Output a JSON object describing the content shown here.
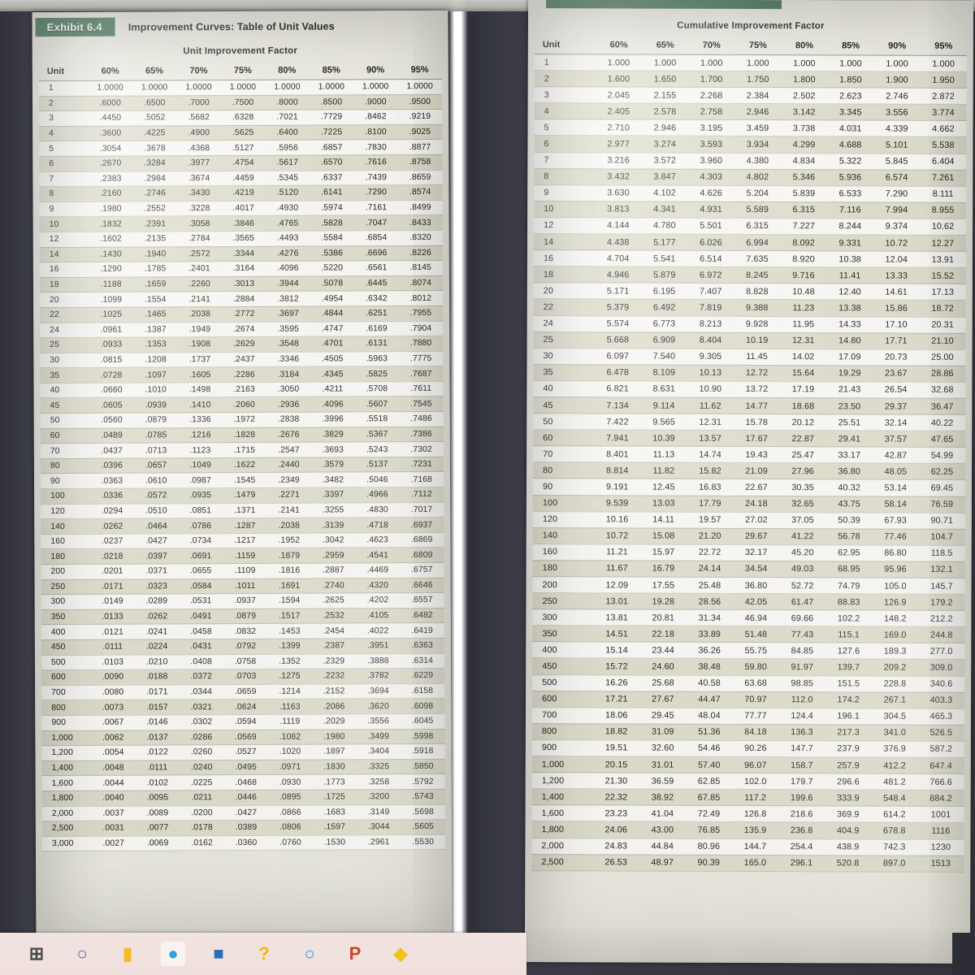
{
  "exhibit": {
    "tag": "Exhibit 6.4",
    "title": "Improvement Curves: Table of Unit Values"
  },
  "left_table": {
    "caption": "Unit Improvement Factor",
    "columns": [
      "Unit",
      "60%",
      "65%",
      "70%",
      "75%",
      "80%",
      "85%",
      "90%",
      "95%"
    ],
    "rows": [
      [
        "1",
        "1.0000",
        "1.0000",
        "1.0000",
        "1.0000",
        "1.0000",
        "1.0000",
        "1.0000",
        "1.0000"
      ],
      [
        "2",
        ".6000",
        ".6500",
        ".7000",
        ".7500",
        ".8000",
        ".8500",
        ".9000",
        ".9500"
      ],
      [
        "3",
        ".4450",
        ".5052",
        ".5682",
        ".6328",
        ".7021",
        ".7729",
        ".8462",
        ".9219"
      ],
      [
        "4",
        ".3600",
        ".4225",
        ".4900",
        ".5625",
        ".6400",
        ".7225",
        ".8100",
        ".9025"
      ],
      [
        "5",
        ".3054",
        ".3678",
        ".4368",
        ".5127",
        ".5956",
        ".6857",
        ".7830",
        ".8877"
      ],
      [
        "6",
        ".2670",
        ".3284",
        ".3977",
        ".4754",
        ".5617",
        ".6570",
        ".7616",
        ".8758"
      ],
      [
        "7",
        ".2383",
        ".2984",
        ".3674",
        ".4459",
        ".5345",
        ".6337",
        ".7439",
        ".8659"
      ],
      [
        "8",
        ".2160",
        ".2746",
        ".3430",
        ".4219",
        ".5120",
        ".6141",
        ".7290",
        ".8574"
      ],
      [
        "9",
        ".1980",
        ".2552",
        ".3228",
        ".4017",
        ".4930",
        ".5974",
        ".7161",
        ".8499"
      ],
      [
        "10",
        ".1832",
        ".2391",
        ".3058",
        ".3846",
        ".4765",
        ".5828",
        ".7047",
        ".8433"
      ],
      [
        "12",
        ".1602",
        ".2135",
        ".2784",
        ".3565",
        ".4493",
        ".5584",
        ".6854",
        ".8320"
      ],
      [
        "14",
        ".1430",
        ".1940",
        ".2572",
        ".3344",
        ".4276",
        ".5386",
        ".6696",
        ".8226"
      ],
      [
        "16",
        ".1290",
        ".1785",
        ".2401",
        ".3164",
        ".4096",
        ".5220",
        ".6561",
        ".8145"
      ],
      [
        "18",
        ".1188",
        ".1659",
        ".2260",
        ".3013",
        ".3944",
        ".5078",
        ".6445",
        ".8074"
      ],
      [
        "20",
        ".1099",
        ".1554",
        ".2141",
        ".2884",
        ".3812",
        ".4954",
        ".6342",
        ".8012"
      ],
      [
        "22",
        ".1025",
        ".1465",
        ".2038",
        ".2772",
        ".3697",
        ".4844",
        ".6251",
        ".7955"
      ],
      [
        "24",
        ".0961",
        ".1387",
        ".1949",
        ".2674",
        ".3595",
        ".4747",
        ".6169",
        ".7904"
      ],
      [
        "25",
        ".0933",
        ".1353",
        ".1908",
        ".2629",
        ".3548",
        ".4701",
        ".6131",
        ".7880"
      ],
      [
        "30",
        ".0815",
        ".1208",
        ".1737",
        ".2437",
        ".3346",
        ".4505",
        ".5963",
        ".7775"
      ],
      [
        "35",
        ".0728",
        ".1097",
        ".1605",
        ".2286",
        ".3184",
        ".4345",
        ".5825",
        ".7687"
      ],
      [
        "40",
        ".0660",
        ".1010",
        ".1498",
        ".2163",
        ".3050",
        ".4211",
        ".5708",
        ".7611"
      ],
      [
        "45",
        ".0605",
        ".0939",
        ".1410",
        ".2060",
        ".2936",
        ".4096",
        ".5607",
        ".7545"
      ],
      [
        "50",
        ".0560",
        ".0879",
        ".1336",
        ".1972",
        ".2838",
        ".3996",
        ".5518",
        ".7486"
      ],
      [
        "60",
        ".0489",
        ".0785",
        ".1216",
        ".1828",
        ".2676",
        ".3829",
        ".5367",
        ".7386"
      ],
      [
        "70",
        ".0437",
        ".0713",
        ".1123",
        ".1715",
        ".2547",
        ".3693",
        ".5243",
        ".7302"
      ],
      [
        "80",
        ".0396",
        ".0657",
        ".1049",
        ".1622",
        ".2440",
        ".3579",
        ".5137",
        ".7231"
      ],
      [
        "90",
        ".0363",
        ".0610",
        ".0987",
        ".1545",
        ".2349",
        ".3482",
        ".5046",
        ".7168"
      ],
      [
        "100",
        ".0336",
        ".0572",
        ".0935",
        ".1479",
        ".2271",
        ".3397",
        ".4966",
        ".7112"
      ],
      [
        "120",
        ".0294",
        ".0510",
        ".0851",
        ".1371",
        ".2141",
        ".3255",
        ".4830",
        ".7017"
      ],
      [
        "140",
        ".0262",
        ".0464",
        ".0786",
        ".1287",
        ".2038",
        ".3139",
        ".4718",
        ".6937"
      ],
      [
        "160",
        ".0237",
        ".0427",
        ".0734",
        ".1217",
        ".1952",
        ".3042",
        ".4623",
        ".6869"
      ],
      [
        "180",
        ".0218",
        ".0397",
        ".0691",
        ".1159",
        ".1879",
        ".2959",
        ".4541",
        ".6809"
      ],
      [
        "200",
        ".0201",
        ".0371",
        ".0655",
        ".1109",
        ".1816",
        ".2887",
        ".4469",
        ".6757"
      ],
      [
        "250",
        ".0171",
        ".0323",
        ".0584",
        ".1011",
        ".1691",
        ".2740",
        ".4320",
        ".6646"
      ],
      [
        "300",
        ".0149",
        ".0289",
        ".0531",
        ".0937",
        ".1594",
        ".2625",
        ".4202",
        ".6557"
      ],
      [
        "350",
        ".0133",
        ".0262",
        ".0491",
        ".0879",
        ".1517",
        ".2532",
        ".4105",
        ".6482"
      ],
      [
        "400",
        ".0121",
        ".0241",
        ".0458",
        ".0832",
        ".1453",
        ".2454",
        ".4022",
        ".6419"
      ],
      [
        "450",
        ".0111",
        ".0224",
        ".0431",
        ".0792",
        ".1399",
        ".2387",
        ".3951",
        ".6363"
      ],
      [
        "500",
        ".0103",
        ".0210",
        ".0408",
        ".0758",
        ".1352",
        ".2329",
        ".3888",
        ".6314"
      ],
      [
        "600",
        ".0090",
        ".0188",
        ".0372",
        ".0703",
        ".1275",
        ".2232",
        ".3782",
        ".6229"
      ],
      [
        "700",
        ".0080",
        ".0171",
        ".0344",
        ".0659",
        ".1214",
        ".2152",
        ".3694",
        ".6158"
      ],
      [
        "800",
        ".0073",
        ".0157",
        ".0321",
        ".0624",
        ".1163",
        ".2086",
        ".3620",
        ".6098"
      ],
      [
        "900",
        ".0067",
        ".0146",
        ".0302",
        ".0594",
        ".1119",
        ".2029",
        ".3556",
        ".6045"
      ],
      [
        "1,000",
        ".0062",
        ".0137",
        ".0286",
        ".0569",
        ".1082",
        ".1980",
        ".3499",
        ".5998"
      ],
      [
        "1,200",
        ".0054",
        ".0122",
        ".0260",
        ".0527",
        ".1020",
        ".1897",
        ".3404",
        ".5918"
      ],
      [
        "1,400",
        ".0048",
        ".0111",
        ".0240",
        ".0495",
        ".0971",
        ".1830",
        ".3325",
        ".5850"
      ],
      [
        "1,600",
        ".0044",
        ".0102",
        ".0225",
        ".0468",
        ".0930",
        ".1773",
        ".3258",
        ".5792"
      ],
      [
        "1,800",
        ".0040",
        ".0095",
        ".0211",
        ".0446",
        ".0895",
        ".1725",
        ".3200",
        ".5743"
      ],
      [
        "2,000",
        ".0037",
        ".0089",
        ".0200",
        ".0427",
        ".0866",
        ".1683",
        ".3149",
        ".5698"
      ],
      [
        "2,500",
        ".0031",
        ".0077",
        ".0178",
        ".0389",
        ".0806",
        ".1597",
        ".3044",
        ".5605"
      ],
      [
        "3,000",
        ".0027",
        ".0069",
        ".0162",
        ".0360",
        ".0760",
        ".1530",
        ".2961",
        ".5530"
      ]
    ]
  },
  "right_table": {
    "caption": "Cumulative Improvement Factor",
    "columns": [
      "Unit",
      "60%",
      "65%",
      "70%",
      "75%",
      "80%",
      "85%",
      "90%",
      "95%"
    ],
    "rows": [
      [
        "1",
        "1.000",
        "1.000",
        "1.000",
        "1.000",
        "1.000",
        "1.000",
        "1.000",
        "1.000"
      ],
      [
        "2",
        "1.600",
        "1.650",
        "1.700",
        "1.750",
        "1.800",
        "1.850",
        "1.900",
        "1.950"
      ],
      [
        "3",
        "2.045",
        "2.155",
        "2.268",
        "2.384",
        "2.502",
        "2.623",
        "2.746",
        "2.872"
      ],
      [
        "4",
        "2.405",
        "2.578",
        "2.758",
        "2.946",
        "3.142",
        "3.345",
        "3.556",
        "3.774"
      ],
      [
        "5",
        "2.710",
        "2.946",
        "3.195",
        "3.459",
        "3.738",
        "4.031",
        "4.339",
        "4.662"
      ],
      [
        "6",
        "2.977",
        "3.274",
        "3.593",
        "3.934",
        "4.299",
        "4.688",
        "5.101",
        "5.538"
      ],
      [
        "7",
        "3.216",
        "3.572",
        "3.960",
        "4.380",
        "4.834",
        "5.322",
        "5.845",
        "6.404"
      ],
      [
        "8",
        "3.432",
        "3.847",
        "4.303",
        "4.802",
        "5.346",
        "5.936",
        "6.574",
        "7.261"
      ],
      [
        "9",
        "3.630",
        "4.102",
        "4.626",
        "5.204",
        "5.839",
        "6.533",
        "7.290",
        "8.111"
      ],
      [
        "10",
        "3.813",
        "4.341",
        "4.931",
        "5.589",
        "6.315",
        "7.116",
        "7.994",
        "8.955"
      ],
      [
        "12",
        "4.144",
        "4.780",
        "5.501",
        "6.315",
        "7.227",
        "8.244",
        "9.374",
        "10.62"
      ],
      [
        "14",
        "4.438",
        "5.177",
        "6.026",
        "6.994",
        "8.092",
        "9.331",
        "10.72",
        "12.27"
      ],
      [
        "16",
        "4.704",
        "5.541",
        "6.514",
        "7.635",
        "8.920",
        "10.38",
        "12.04",
        "13.91"
      ],
      [
        "18",
        "4.946",
        "5.879",
        "6.972",
        "8.245",
        "9.716",
        "11.41",
        "13.33",
        "15.52"
      ],
      [
        "20",
        "5.171",
        "6.195",
        "7.407",
        "8.828",
        "10.48",
        "12.40",
        "14.61",
        "17.13"
      ],
      [
        "22",
        "5.379",
        "6.492",
        "7.819",
        "9.388",
        "11.23",
        "13.38",
        "15.86",
        "18.72"
      ],
      [
        "24",
        "5.574",
        "6.773",
        "8.213",
        "9.928",
        "11.95",
        "14.33",
        "17.10",
        "20.31"
      ],
      [
        "25",
        "5.668",
        "6.909",
        "8.404",
        "10.19",
        "12.31",
        "14.80",
        "17.71",
        "21.10"
      ],
      [
        "30",
        "6.097",
        "7.540",
        "9.305",
        "11.45",
        "14.02",
        "17.09",
        "20.73",
        "25.00"
      ],
      [
        "35",
        "6.478",
        "8.109",
        "10.13",
        "12.72",
        "15.64",
        "19.29",
        "23.67",
        "28.86"
      ],
      [
        "40",
        "6.821",
        "8.631",
        "10.90",
        "13.72",
        "17.19",
        "21.43",
        "26.54",
        "32.68"
      ],
      [
        "45",
        "7.134",
        "9.114",
        "11.62",
        "14.77",
        "18.68",
        "23.50",
        "29.37",
        "36.47"
      ],
      [
        "50",
        "7.422",
        "9.565",
        "12.31",
        "15.78",
        "20.12",
        "25.51",
        "32.14",
        "40.22"
      ],
      [
        "60",
        "7.941",
        "10.39",
        "13.57",
        "17.67",
        "22.87",
        "29.41",
        "37.57",
        "47.65"
      ],
      [
        "70",
        "8.401",
        "11.13",
        "14.74",
        "19.43",
        "25.47",
        "33.17",
        "42.87",
        "54.99"
      ],
      [
        "80",
        "8.814",
        "11.82",
        "15.82",
        "21.09",
        "27.96",
        "36.80",
        "48.05",
        "62.25"
      ],
      [
        "90",
        "9.191",
        "12.45",
        "16.83",
        "22.67",
        "30.35",
        "40.32",
        "53.14",
        "69.45"
      ],
      [
        "100",
        "9.539",
        "13.03",
        "17.79",
        "24.18",
        "32.65",
        "43.75",
        "58.14",
        "76.59"
      ],
      [
        "120",
        "10.16",
        "14.11",
        "19.57",
        "27.02",
        "37.05",
        "50.39",
        "67.93",
        "90.71"
      ],
      [
        "140",
        "10.72",
        "15.08",
        "21.20",
        "29.67",
        "41.22",
        "56.78",
        "77.46",
        "104.7"
      ],
      [
        "160",
        "11.21",
        "15.97",
        "22.72",
        "32.17",
        "45.20",
        "62.95",
        "86.80",
        "118.5"
      ],
      [
        "180",
        "11.67",
        "16.79",
        "24.14",
        "34.54",
        "49.03",
        "68.95",
        "95.96",
        "132.1"
      ],
      [
        "200",
        "12.09",
        "17.55",
        "25.48",
        "36.80",
        "52.72",
        "74.79",
        "105.0",
        "145.7"
      ],
      [
        "250",
        "13.01",
        "19.28",
        "28.56",
        "42.05",
        "61.47",
        "88.83",
        "126.9",
        "179.2"
      ],
      [
        "300",
        "13.81",
        "20.81",
        "31.34",
        "46.94",
        "69.66",
        "102.2",
        "148.2",
        "212.2"
      ],
      [
        "350",
        "14.51",
        "22.18",
        "33.89",
        "51.48",
        "77.43",
        "115.1",
        "169.0",
        "244.8"
      ],
      [
        "400",
        "15.14",
        "23.44",
        "36.26",
        "55.75",
        "84.85",
        "127.6",
        "189.3",
        "277.0"
      ],
      [
        "450",
        "15.72",
        "24.60",
        "38.48",
        "59.80",
        "91.97",
        "139.7",
        "209.2",
        "309.0"
      ],
      [
        "500",
        "16.26",
        "25.68",
        "40.58",
        "63.68",
        "98.85",
        "151.5",
        "228.8",
        "340.6"
      ],
      [
        "600",
        "17.21",
        "27.67",
        "44.47",
        "70.97",
        "112.0",
        "174.2",
        "267.1",
        "403.3"
      ],
      [
        "700",
        "18.06",
        "29.45",
        "48.04",
        "77.77",
        "124.4",
        "196.1",
        "304.5",
        "465.3"
      ],
      [
        "800",
        "18.82",
        "31.09",
        "51.36",
        "84.18",
        "136.3",
        "217.3",
        "341.0",
        "526.5"
      ],
      [
        "900",
        "19.51",
        "32.60",
        "54.46",
        "90.26",
        "147.7",
        "237.9",
        "376.9",
        "587.2"
      ],
      [
        "1,000",
        "20.15",
        "31.01",
        "57.40",
        "96.07",
        "158.7",
        "257.9",
        "412.2",
        "647.4"
      ],
      [
        "1,200",
        "21.30",
        "36.59",
        "62.85",
        "102.0",
        "179.7",
        "296.6",
        "481.2",
        "766.6"
      ],
      [
        "1,400",
        "22.32",
        "38.92",
        "67.85",
        "117.2",
        "199.6",
        "333.9",
        "548.4",
        "884.2"
      ],
      [
        "1,600",
        "23.23",
        "41.04",
        "72.49",
        "126.8",
        "218.6",
        "369.9",
        "614.2",
        "1001"
      ],
      [
        "1,800",
        "24.06",
        "43.00",
        "76.85",
        "135.9",
        "236.8",
        "404.9",
        "678.8",
        "1116"
      ],
      [
        "2,000",
        "24.83",
        "44.84",
        "80.96",
        "144.7",
        "254.4",
        "438.9",
        "742.3",
        "1230"
      ],
      [
        "2,500",
        "26.53",
        "48.97",
        "90.39",
        "165.0",
        "296.1",
        "520.8",
        "897.0",
        "1513"
      ]
    ]
  },
  "taskbar": {
    "items": [
      {
        "name": "start-icon",
        "glyph": "⊞",
        "color": "#4a4a4a"
      },
      {
        "name": "search-icon",
        "glyph": "○",
        "color": "#5b5fa8"
      },
      {
        "name": "file-explorer-icon",
        "glyph": "▮",
        "color": "#f4bb2a"
      },
      {
        "name": "edge-browser-icon",
        "glyph": "●",
        "color": "#2aa5d8"
      },
      {
        "name": "microsoft-store-icon",
        "glyph": "■",
        "color": "#2a6fb5"
      },
      {
        "name": "help-icon",
        "glyph": "?",
        "color": "#f2b705"
      },
      {
        "name": "cortana-icon",
        "glyph": "○",
        "color": "#1a9bd7"
      },
      {
        "name": "powerpoint-icon",
        "glyph": "P",
        "color": "#d04423"
      },
      {
        "name": "windows-security-icon",
        "glyph": "◆",
        "color": "#f3c218"
      }
    ]
  },
  "colors": {
    "exhibit_green": "#4e7a5e",
    "page_cream": "#e9e8e0",
    "row_alt": "#cdc9b2",
    "background_dark": "#35363f"
  }
}
